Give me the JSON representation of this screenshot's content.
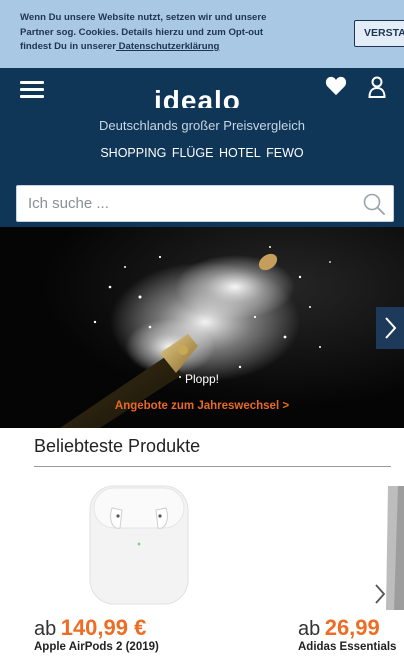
{
  "cookie_banner": {
    "line1": "Wenn Du unsere Website nutzt, setzen wir und unsere",
    "line2": "Partner sog. Cookies. Details hierzu und zum Opt-out",
    "line3_prefix": "findest Du in unserer",
    "link_text": " Datenschutzerklärung",
    "button_label": "VERSTANDEN"
  },
  "header": {
    "logo": "idealo",
    "tagline": "Deutschlands großer Preisvergleich",
    "nav": [
      "SHOPPING",
      "FLÜGE",
      "HOTEL",
      "FEWO"
    ],
    "icons": {
      "menu": "hamburger-menu-icon",
      "wishlist": "heart-icon",
      "account": "user-icon"
    },
    "accent_color": "#0f3557"
  },
  "search": {
    "placeholder": "Ich suche ...",
    "value": ""
  },
  "hero": {
    "title": "Plopp!",
    "cta": "Angebote zum Jahreswechsel >"
  },
  "products": {
    "section_title": "Beliebteste Produkte",
    "items": [
      {
        "price_prefix": "ab",
        "price": "140,99 €",
        "name": "Apple AirPods 2 (2019)"
      },
      {
        "price_prefix": "ab",
        "price": "26,99",
        "name": "Adidas Essentials"
      }
    ],
    "price_color": "#ef6c24"
  }
}
